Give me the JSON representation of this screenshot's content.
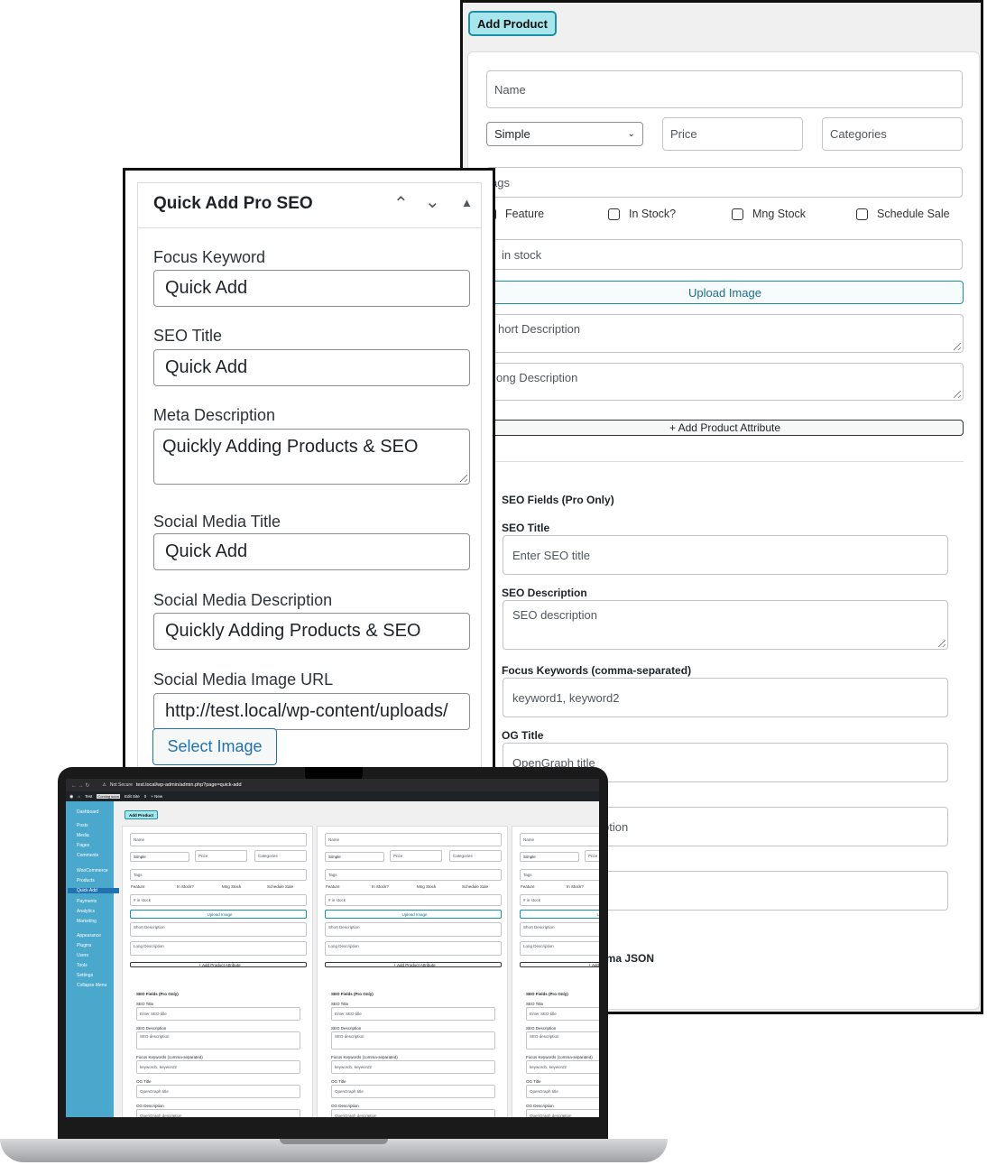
{
  "right_panel": {
    "add_product_label": "Add Product",
    "name_placeholder": "Name",
    "type_selected": "Simple",
    "price_placeholder": "Price",
    "categories_placeholder": "Categories",
    "tags_placeholder": "ags",
    "checkboxes": [
      "Feature",
      "In Stock?",
      "Mng Stock",
      "Schedule Sale"
    ],
    "stock_placeholder": "in stock",
    "upload_image_label": "Upload Image",
    "short_desc_placeholder": "hort Description",
    "long_desc_placeholder": "ong Description",
    "add_attribute_label": "+ Add Product Attribute",
    "seo_heading": "SEO Fields (Pro Only)",
    "seo_title_label": "SEO Title",
    "seo_title_placeholder": "Enter SEO title",
    "seo_desc_label": "SEO Description",
    "seo_desc_placeholder": "SEO description",
    "focus_kw_label": "Focus Keywords (comma-separated)",
    "focus_kw_placeholder": "keyword1, keyword2",
    "og_title_label": "OG Title",
    "og_title_placeholder": "OpenGraph title",
    "og_desc_partial": "ption",
    "schema_partial": "ema JSON"
  },
  "left_panel": {
    "title": "Quick Add Pro SEO",
    "focus_keyword_label": "Focus Keyword",
    "focus_keyword_value": "Quick Add",
    "seo_title_label": "SEO Title",
    "seo_title_value": "Quick Add",
    "meta_description_label": "Meta Description",
    "meta_description_value": "Quickly Adding Products & SEO",
    "social_title_label": "Social Media Title",
    "social_title_value": "Quick Add",
    "social_desc_label": "Social Media Description",
    "social_desc_value": "Quickly Adding Products & SEO",
    "social_image_label": "Social Media Image URL",
    "social_image_value": "http://test.local/wp-content/uploads/",
    "select_image_label": "Select Image"
  },
  "laptop": {
    "not_secure": "Not Secure",
    "url": "test.local/wp-admin/admin.php?page=quick-add",
    "adminbar_site": "Test",
    "adminbar_badge": "Coming soon",
    "adminbar_edit": "Edit Site",
    "adminbar_comments": "0",
    "adminbar_new": "+ New",
    "sidebar": [
      "Dashboard",
      "Posts",
      "Media",
      "Pages",
      "Comments",
      "WooCommerce",
      "Products",
      "Quick Add",
      "Payments",
      "Analytics",
      "Marketing",
      "Appearance",
      "Plugins",
      "Users",
      "Tools",
      "Settings",
      "Collapse Menu"
    ],
    "add_product": "Add Product",
    "col": {
      "name": "Name",
      "simple": "Simple",
      "price": "Price",
      "categories": "Categories",
      "tags": "Tags",
      "feature": "Feature",
      "instock": "In Stock?",
      "mng": "Mng Stock",
      "sched": "Schedule Sale",
      "stock": "# in stock",
      "upload": "Upload Image",
      "short": "Short Description",
      "long": "Long Description",
      "attr": "+ Add Product Attribute",
      "attr_partial": "+ Add",
      "seo": "SEO Fields (Pro Only)",
      "seo_title": "SEO Title",
      "enter_seo": "Enter SEO title",
      "seo_desc": "SEO Description",
      "seo_desc_ph": "SEO description",
      "focus": "Focus Keywords (comma-separated)",
      "kw": "keyword1, keyword2",
      "og_title": "OG Title",
      "og_ph": "OpenGraph title",
      "og_desc": "OG Description",
      "og_desc_ph": "OpenGraph description"
    }
  }
}
